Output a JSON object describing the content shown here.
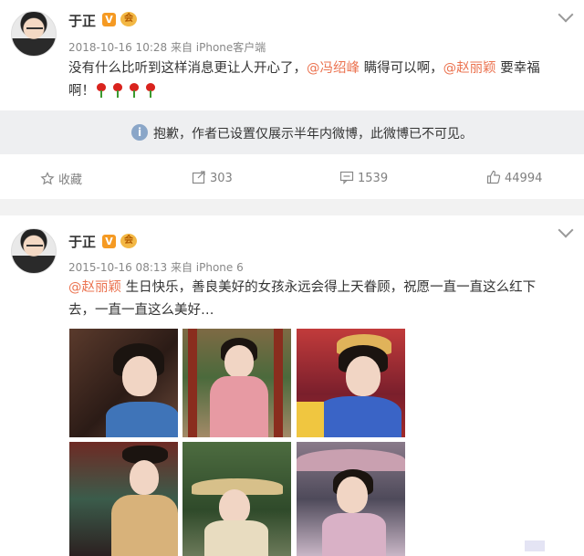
{
  "posts": [
    {
      "author": "于正",
      "verified_badge": "V",
      "member_badge": "会",
      "timestamp": "2018-10-16 10:28",
      "source": "来自 iPhone客户端",
      "text_parts": [
        "没有什么比听到这样消息更让人开心了，",
        "@冯绍峰",
        " 瞒得可以啊，",
        "@赵丽颖",
        " 要幸福"
      ],
      "text_line2": "啊！",
      "emoji": "rose-emoji",
      "notice_icon": "info-icon",
      "notice": "抱歉，作者已设置仅展示半年内微博，此微博已不可见。",
      "actions": {
        "favorite_label": "收藏",
        "repost_count": "303",
        "comment_count": "1539",
        "like_count": "44994"
      }
    },
    {
      "author": "于正",
      "verified_badge": "V",
      "member_badge": "会",
      "timestamp": "2015-10-16 08:13",
      "source": "来自 iPhone 6",
      "text_mention": "@赵丽颖",
      "text_line1": " 生日快乐，善良美好的女孩永远会得上天眷顾，祝愿一直一直这么红下",
      "text_line2": "去，一直一直这么美好…"
    }
  ],
  "colors": {
    "mention": "#eb7350",
    "notice_bg": "#eeeff1",
    "verified": "#f59a23",
    "action_text": "#808080"
  }
}
